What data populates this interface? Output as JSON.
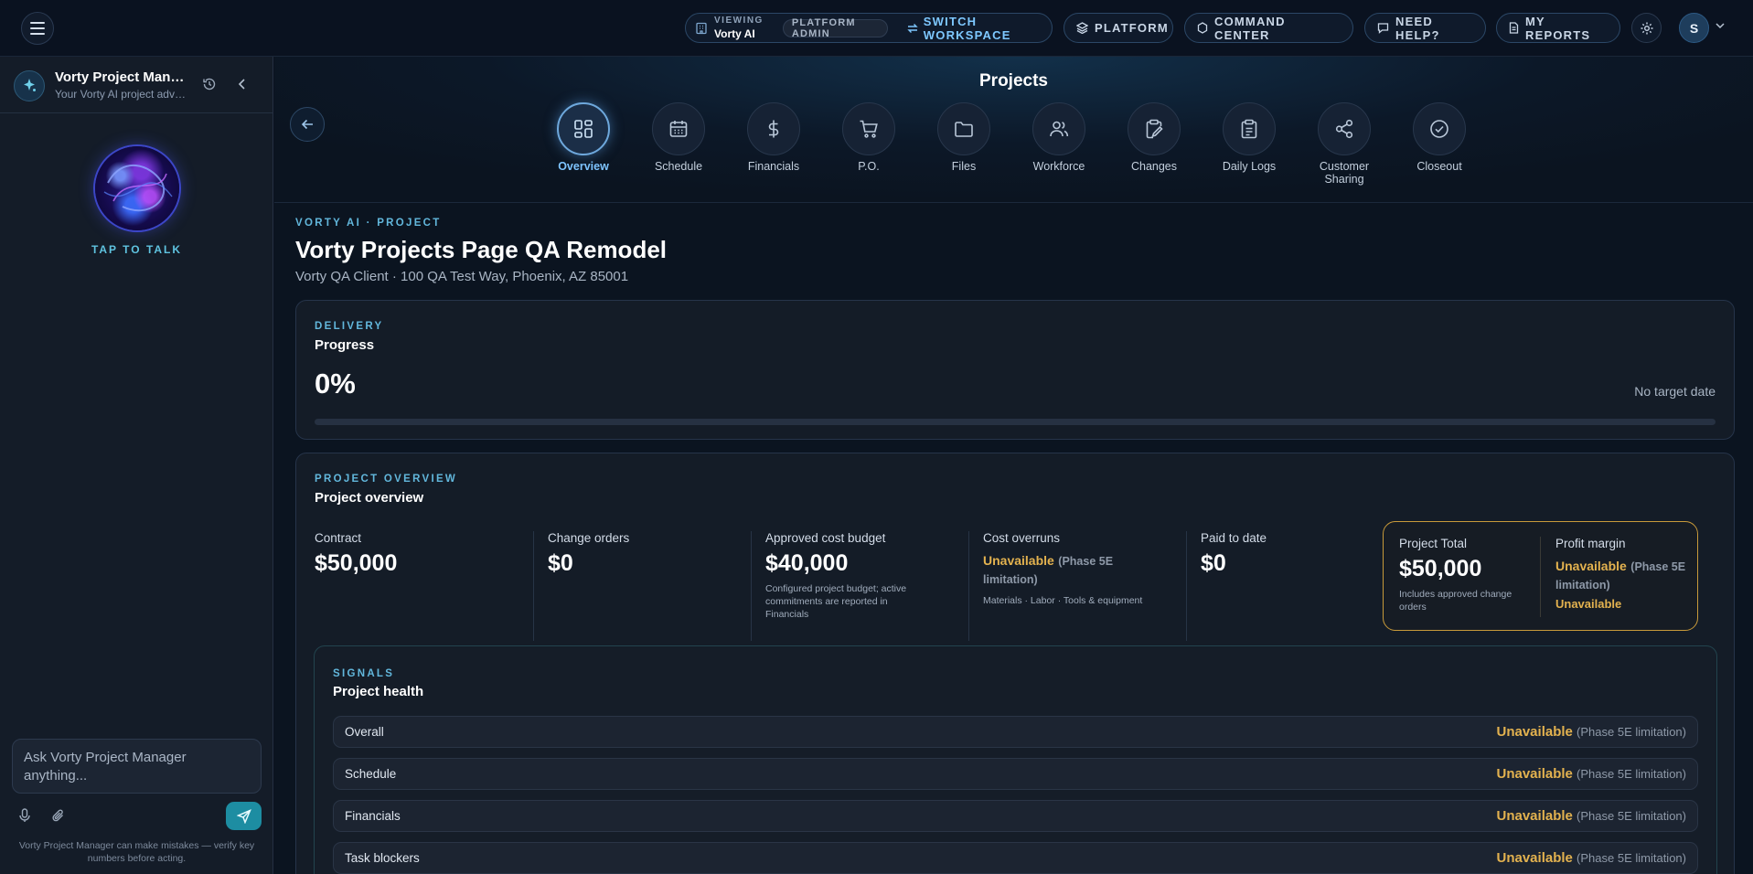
{
  "topbar": {
    "viewing_label": "VIEWING",
    "viewing_value": "Vorty AI",
    "role_chip": "PLATFORM ADMIN",
    "switch_workspace": "SWITCH WORKSPACE",
    "platform": "PLATFORM",
    "command_center": "COMMAND CENTER",
    "need_help": "NEED HELP?",
    "my_reports": "MY REPORTS",
    "avatar_initial": "S"
  },
  "sidebar": {
    "assistant_name": "Vorty Project Manager",
    "assistant_subtitle": "Your Vorty AI project advisor",
    "tap_to_talk": "TAP TO TALK",
    "chat_placeholder": "Ask Vorty Project Manager anything...",
    "disclaimer": "Vorty Project Manager can make mistakes — verify key numbers before acting."
  },
  "header": {
    "page_title": "Projects",
    "tabs": [
      {
        "label": "Overview",
        "icon": "grid-icon",
        "active": true
      },
      {
        "label": "Schedule",
        "icon": "calendar-icon",
        "active": false
      },
      {
        "label": "Financials",
        "icon": "dollar-icon",
        "active": false
      },
      {
        "label": "P.O.",
        "icon": "cart-icon",
        "active": false
      },
      {
        "label": "Files",
        "icon": "folder-icon",
        "active": false
      },
      {
        "label": "Workforce",
        "icon": "users-icon",
        "active": false
      },
      {
        "label": "Changes",
        "icon": "clipboard-edit-icon",
        "active": false
      },
      {
        "label": "Daily Logs",
        "icon": "clipboard-list-icon",
        "active": false
      },
      {
        "label": "Customer Sharing",
        "icon": "share-icon",
        "active": false
      },
      {
        "label": "Closeout",
        "icon": "check-circle-icon",
        "active": false
      }
    ]
  },
  "project": {
    "eyebrow": "VORTY AI · PROJECT",
    "title": "Vorty Projects Page QA Remodel",
    "subtitle": "Vorty QA Client · 100 QA Test Way, Phoenix, AZ 85001"
  },
  "delivery": {
    "eyebrow": "DELIVERY",
    "title": "Progress",
    "progress_text": "0%",
    "progress_fraction": 0,
    "target_date": "No target date"
  },
  "overview": {
    "eyebrow": "PROJECT OVERVIEW",
    "title": "Project overview",
    "contract_label": "Contract",
    "contract_value": "$50,000",
    "change_orders_label": "Change orders",
    "change_orders_value": "$0",
    "budget_label": "Approved cost budget",
    "budget_value": "$40,000",
    "budget_note": "Configured project budget; active commitments are reported in Financials",
    "overruns_label": "Cost overruns",
    "overruns_status": "Unavailable",
    "overruns_phase": "(Phase 5E limitation)",
    "overruns_note": "Materials · Labor · Tools & equipment",
    "paid_label": "Paid to date",
    "paid_value": "$0",
    "total_label": "Project Total",
    "total_value": "$50,000",
    "total_note": "Includes approved change orders",
    "margin_label": "Profit margin",
    "margin_status": "Unavailable",
    "margin_phase": "(Phase 5E limitation)",
    "margin_sub": "Unavailable"
  },
  "signals": {
    "eyebrow": "SIGNALS",
    "title": "Project health",
    "rows": [
      {
        "name": "Overall",
        "status": "Unavailable",
        "phase": "(Phase 5E limitation)"
      },
      {
        "name": "Schedule",
        "status": "Unavailable",
        "phase": "(Phase 5E limitation)"
      },
      {
        "name": "Financials",
        "status": "Unavailable",
        "phase": "(Phase 5E limitation)"
      },
      {
        "name": "Task blockers",
        "status": "Unavailable",
        "phase": "(Phase 5E limitation)"
      }
    ]
  },
  "colors": {
    "accent": "#62b7dc",
    "warning": "#e3b24f",
    "background": "#0b1220"
  }
}
